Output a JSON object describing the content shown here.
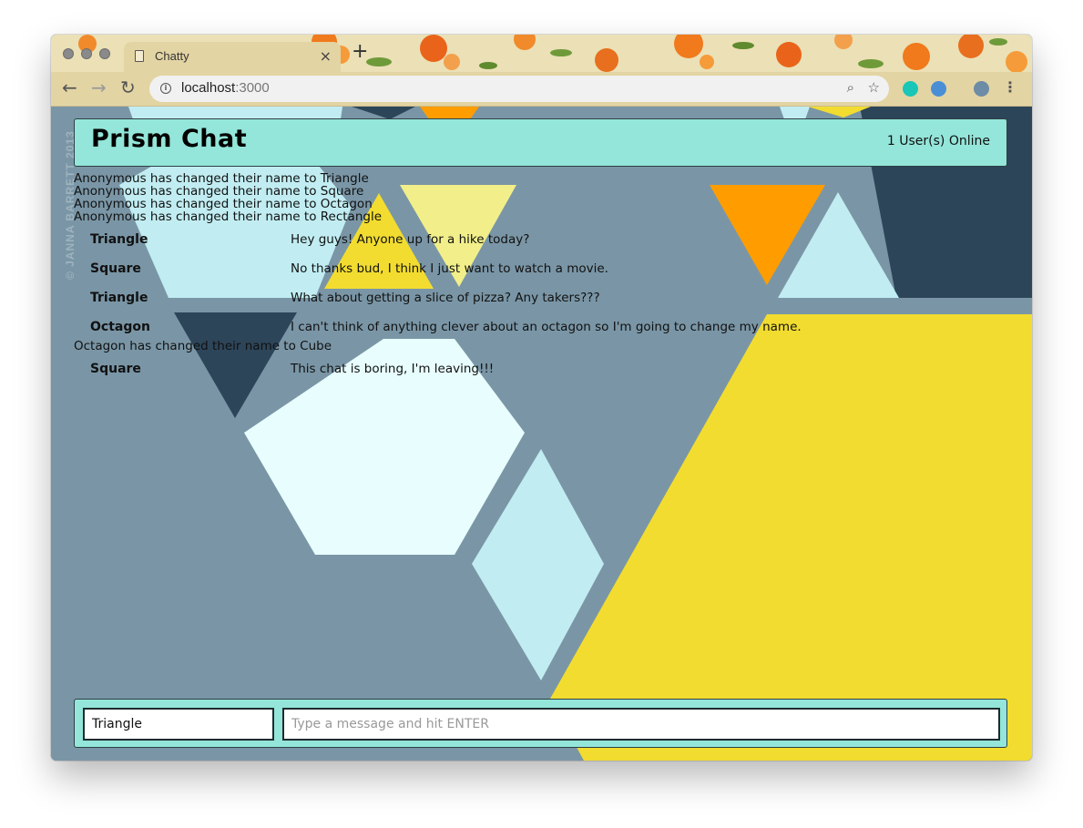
{
  "browser": {
    "tab_title": "Chatty",
    "new_tab_label": "+",
    "close_tab_label": "×",
    "url_host": "localhost",
    "url_port": ":3000"
  },
  "app": {
    "brand": "Prism Chat",
    "online_count_text": "1 User(s) Online",
    "watermark": "© JANNA BARRETT 2013"
  },
  "messages": [
    {
      "type": "system",
      "text": "Anonymous has changed their name to Triangle"
    },
    {
      "type": "system",
      "text": "Anonymous has changed their name to Square"
    },
    {
      "type": "system",
      "text": "Anonymous has changed their name to Octagon"
    },
    {
      "type": "system",
      "text": "Anonymous has changed their name to Rectangle"
    },
    {
      "type": "message",
      "user": "Triangle",
      "text": "Hey guys! Anyone up for a hike today?"
    },
    {
      "type": "message",
      "user": "Square",
      "text": "No thanks bud, I think I just want to watch a movie."
    },
    {
      "type": "message",
      "user": "Triangle",
      "text": "What about getting a slice of pizza? Any takers???"
    },
    {
      "type": "message",
      "user": "Octagon",
      "text": "I can't think of anything clever about an octagon so I'm going to change my name."
    },
    {
      "type": "system",
      "text": "Octagon has changed their name to Cube"
    },
    {
      "type": "message",
      "user": "Square",
      "text": "This chat is boring, I'm leaving!!!"
    }
  ],
  "chatbar": {
    "username_value": "Triangle",
    "message_placeholder": "Type a message and hit ENTER"
  },
  "colors": {
    "navbar_bg": "#93e6d9",
    "page_bg": "#7a96a6",
    "yellow": "#f2dc30",
    "orange": "#ff9d00",
    "light_blue": "#c1edf2",
    "navy": "#2d4559"
  }
}
